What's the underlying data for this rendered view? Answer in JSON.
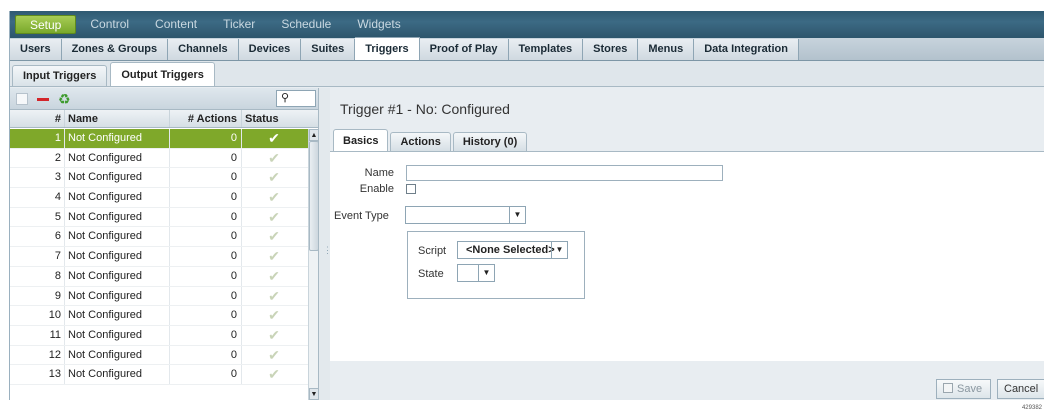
{
  "topnav": [
    "Setup",
    "Control",
    "Content",
    "Ticker",
    "Schedule",
    "Widgets"
  ],
  "subnav": [
    "Users",
    "Zones & Groups",
    "Channels",
    "Devices",
    "Suites",
    "Triggers",
    "Proof of Play",
    "Templates",
    "Stores",
    "Menus",
    "Data Integration"
  ],
  "trigger_tabs": [
    "Input Triggers",
    "Output Triggers"
  ],
  "list": {
    "columns": {
      "num": "#",
      "name": "Name",
      "actions": "# Actions",
      "status": "Status"
    },
    "rows": [
      {
        "num": "1",
        "name": "Not Configured",
        "actions": "0"
      },
      {
        "num": "2",
        "name": "Not Configured",
        "actions": "0"
      },
      {
        "num": "3",
        "name": "Not Configured",
        "actions": "0"
      },
      {
        "num": "4",
        "name": "Not Configured",
        "actions": "0"
      },
      {
        "num": "5",
        "name": "Not Configured",
        "actions": "0"
      },
      {
        "num": "6",
        "name": "Not Configured",
        "actions": "0"
      },
      {
        "num": "7",
        "name": "Not Configured",
        "actions": "0"
      },
      {
        "num": "8",
        "name": "Not Configured",
        "actions": "0"
      },
      {
        "num": "9",
        "name": "Not Configured",
        "actions": "0"
      },
      {
        "num": "10",
        "name": "Not Configured",
        "actions": "0"
      },
      {
        "num": "11",
        "name": "Not Configured",
        "actions": "0"
      },
      {
        "num": "12",
        "name": "Not Configured",
        "actions": "0"
      },
      {
        "num": "13",
        "name": "Not Configured",
        "actions": "0"
      }
    ]
  },
  "detail": {
    "title": "Trigger #1 - No: Configured",
    "tabs": [
      "Basics",
      "Actions",
      "History (0)"
    ],
    "name_label": "Name",
    "enable_label": "Enable",
    "event_type_label": "Event Type",
    "script_label": "Script",
    "script_value": "<None Selected>",
    "state_label": "State"
  },
  "buttons": {
    "save": "Save",
    "cancel": "Cancel"
  },
  "footer_id": "429382"
}
